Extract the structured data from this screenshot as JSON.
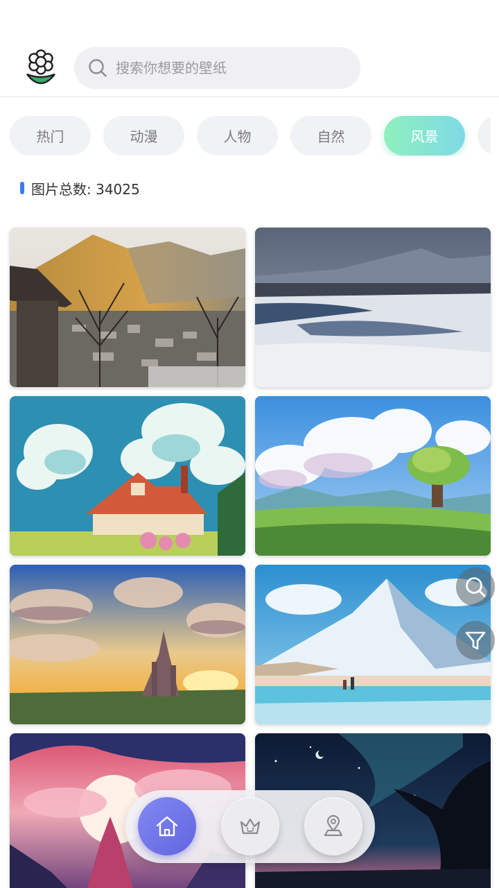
{
  "header": {
    "logo_icon": "flower-icon",
    "search": {
      "placeholder": "搜索你想要的壁纸",
      "value": "",
      "icon": "search-icon"
    }
  },
  "categories": {
    "items": [
      "热门",
      "动漫",
      "人物",
      "自然",
      "风景",
      ""
    ],
    "selected": "风景"
  },
  "gallery": {
    "count_text": "图片总数: 34025",
    "images": [
      {
        "subject": "mountain village at sunset"
      },
      {
        "subject": "snowy river and mountains"
      },
      {
        "subject": "pixel-art house under clouds"
      },
      {
        "subject": "green tree on meadow"
      },
      {
        "subject": "castle under sunset clouds"
      },
      {
        "subject": "snowy mountain with lake"
      },
      {
        "subject": "pink sky with castle"
      },
      {
        "subject": "night tree under starry sky"
      }
    ]
  },
  "floating_actions": {
    "search_icon": "search-icon",
    "filter_icon": "filter-icon"
  },
  "bottom_nav": {
    "items": [
      "home-icon",
      "crown-icon",
      "user-location-icon"
    ],
    "active": "home-icon"
  },
  "colors": {
    "accent_tab": "#7fe3cf",
    "nav_active": "#6b6fe8",
    "count_bar": "#3b7cf0"
  }
}
